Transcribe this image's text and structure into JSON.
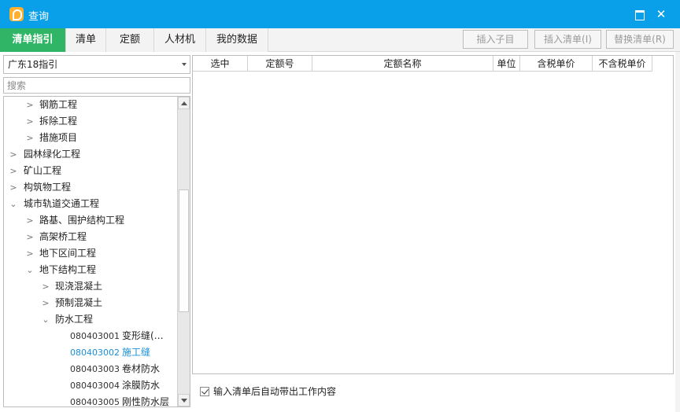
{
  "title": "查询",
  "tabs": [
    {
      "label": "清单指引",
      "active": true
    },
    {
      "label": "清单",
      "active": false
    },
    {
      "label": "定额",
      "active": false
    },
    {
      "label": "人材机",
      "active": false
    },
    {
      "label": "我的数据",
      "active": false
    }
  ],
  "toolbar": {
    "insert_child": "插入子目",
    "insert_list": "插入清单(I)",
    "replace_list": "替换清单(R)"
  },
  "left": {
    "combo_value": "广东18指引",
    "search_placeholder": "搜索"
  },
  "tree": [
    {
      "label": "钢筋工程",
      "level": 2,
      "state": "collapsed"
    },
    {
      "label": "拆除工程",
      "level": 2,
      "state": "collapsed"
    },
    {
      "label": "措施项目",
      "level": 2,
      "state": "collapsed"
    },
    {
      "label": "园林绿化工程",
      "level": 1,
      "state": "collapsed"
    },
    {
      "label": "矿山工程",
      "level": 1,
      "state": "collapsed"
    },
    {
      "label": "构筑物工程",
      "level": 1,
      "state": "collapsed"
    },
    {
      "label": "城市轨道交通工程",
      "level": 1,
      "state": "expanded"
    },
    {
      "label": "路基、围护结构工程",
      "level": 2,
      "state": "collapsed"
    },
    {
      "label": "高架桥工程",
      "level": 2,
      "state": "collapsed"
    },
    {
      "label": "地下区间工程",
      "level": 2,
      "state": "collapsed"
    },
    {
      "label": "地下结构工程",
      "level": 2,
      "state": "expanded"
    },
    {
      "label": "现浇混凝土",
      "level": 3,
      "state": "collapsed"
    },
    {
      "label": "预制混凝土",
      "level": 3,
      "state": "collapsed"
    },
    {
      "label": "防水工程",
      "level": 3,
      "state": "expanded"
    }
  ],
  "leaves": [
    {
      "code": "080403001",
      "name": "变形缝(…",
      "selected": false
    },
    {
      "code": "080403002",
      "name": "施工缝",
      "selected": true
    },
    {
      "code": "080403003",
      "name": "卷材防水",
      "selected": false
    },
    {
      "code": "080403004",
      "name": "涂膜防水",
      "selected": false
    },
    {
      "code": "080403005",
      "name": "刚性防水层",
      "selected": false
    }
  ],
  "grid": {
    "columns": [
      "选中",
      "定额号",
      "定额名称",
      "单位",
      "含税单价",
      "不含税单价"
    ]
  },
  "footer": {
    "auto_bring_label": "输入清单后自动带出工作内容",
    "auto_bring_checked": true
  },
  "colors": {
    "titlebar": "#0aa0e9",
    "active_tab": "#2fb565",
    "selected_text": "#1a8fd8"
  }
}
